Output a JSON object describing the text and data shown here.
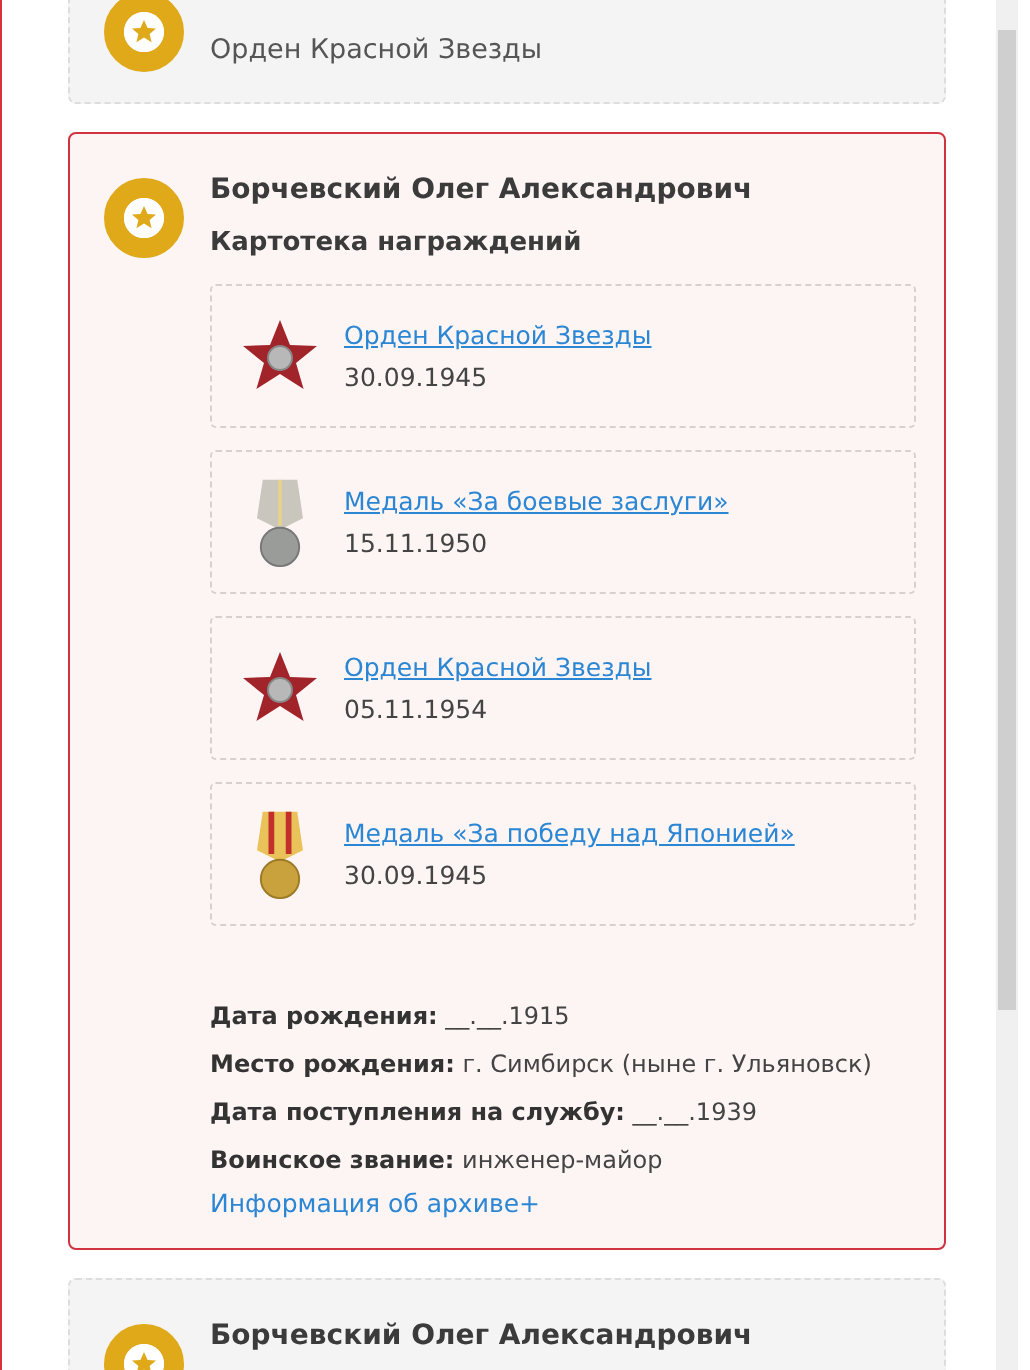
{
  "cards": [
    {
      "subtitle": "Орден Красной Звезды",
      "selected": false
    },
    {
      "title": "Борчевский Олег Александрович",
      "selected": true,
      "section": "Картотека награждений",
      "awards": [
        {
          "kind": "star",
          "name": "Орден Красной Звезды",
          "date": "30.09.1945"
        },
        {
          "kind": "medal-gray",
          "name": "Медаль «За боевые заслуги»",
          "date": "15.11.1950"
        },
        {
          "kind": "star",
          "name": "Орден Красной Звезды",
          "date": "05.11.1954"
        },
        {
          "kind": "medal-striped",
          "name": "Медаль «За победу над Японией»",
          "date": "30.09.1945"
        }
      ],
      "details": [
        {
          "label": "Дата рождения:",
          "value": "__.__.1915"
        },
        {
          "label": "Место рождения:",
          "value": "г. Симбирск (ныне г. Ульяновск)"
        },
        {
          "label": "Дата поступления на службу:",
          "value": "__.__.1939"
        },
        {
          "label": "Воинское звание:",
          "value": "инженер-майор"
        }
      ],
      "archive_link": "Информация об архиве+"
    },
    {
      "title": "Борчевский Олег Александрович",
      "selected": false
    }
  ]
}
